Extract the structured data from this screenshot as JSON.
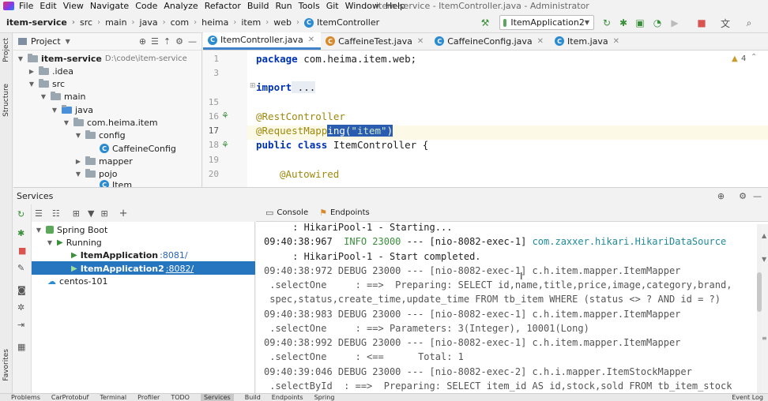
{
  "menubar": {
    "items": [
      "File",
      "Edit",
      "View",
      "Navigate",
      "Code",
      "Analyze",
      "Refactor",
      "Build",
      "Run",
      "Tools",
      "Git",
      "Window",
      "Help"
    ],
    "window_title": "item-service - ItemController.java - Administrator"
  },
  "breadcrumb": [
    "item-service",
    "src",
    "main",
    "java",
    "com",
    "heima",
    "item",
    "web",
    "ItemController"
  ],
  "run_config": "ItemApplication2",
  "project": {
    "title": "Project",
    "tree": [
      {
        "label": "item-service",
        "extra": "D:\\code\\item-service"
      },
      {
        "label": ".idea"
      },
      {
        "label": "src"
      },
      {
        "label": "main"
      },
      {
        "label": "java"
      },
      {
        "label": "com.heima.item"
      },
      {
        "label": "config"
      },
      {
        "label": "CaffeineConfig"
      },
      {
        "label": "mapper"
      },
      {
        "label": "pojo"
      },
      {
        "label": "Item"
      }
    ]
  },
  "editor": {
    "tabs": [
      "ItemController.java",
      "CaffeineTest.java",
      "CaffeineConfig.java",
      "Item.java"
    ],
    "warning_count": "4",
    "line_numbers": [
      "1",
      "3",
      "",
      "15",
      "16",
      "17",
      "18",
      "19",
      "20"
    ],
    "code": {
      "l1_kw": "package",
      "l1_rest": " com.heima.item.web;",
      "l3_kw": "import",
      "l3_rest": " ...",
      "l16": "@RestController",
      "l17_ann": "@RequestMapp",
      "l17_sel": "ing(",
      "l17_str": "\"item\"",
      "l17_end": ")",
      "l18_kw": "public class",
      "l18_rest": " ItemController {",
      "l20": "@Autowired"
    }
  },
  "services": {
    "title": "Services",
    "tree": {
      "root": "Spring Boot",
      "running": "Running",
      "app1": "ItemApplication",
      "app1_port": ":8081/",
      "app2": "ItemApplication2",
      "app2_port": ":8082/",
      "docker": "centos-101"
    },
    "console_tabs": [
      "Console",
      "Endpoints"
    ],
    "log": [
      "     : HikariPool-1 - Starting...",
      "09:40:38:967  INFO 23000 --- [nio-8082-exec-1] com.zaxxer.hikari.HikariDataSource",
      "     : HikariPool-1 - Start completed.",
      "09:40:38:972 DEBUG 23000 --- [nio-8082-exec-1] c.h.item.mapper.ItemMapper",
      " .selectOne     : ==>  Preparing: SELECT id,name,title,price,image,category,brand,",
      " spec,status,create_time,update_time FROM tb_item WHERE (status <> ? AND id = ?)",
      "09:40:38:983 DEBUG 23000 --- [nio-8082-exec-1] c.h.item.mapper.ItemMapper",
      " .selectOne     : ==> Parameters: 3(Integer), 10001(Long)",
      "09:40:38:992 DEBUG 23000 --- [nio-8082-exec-1] c.h.item.mapper.ItemMapper",
      " .selectOne     : <==      Total: 1",
      "09:40:39:046 DEBUG 23000 --- [nio-8082-exec-2] c.h.i.mapper.ItemStockMapper",
      " .selectById  : ==>  Preparing: SELECT item_id AS id,stock,sold FROM tb_item_stock"
    ]
  },
  "left_strip": [
    "Project",
    "Structure",
    "Favorites"
  ],
  "statusbar": [
    "Problems",
    "CarProtobuf",
    "Terminal",
    "Profiler",
    "TODO",
    "Services",
    "Build",
    "Endpoints",
    "Spring",
    "Event Log"
  ]
}
